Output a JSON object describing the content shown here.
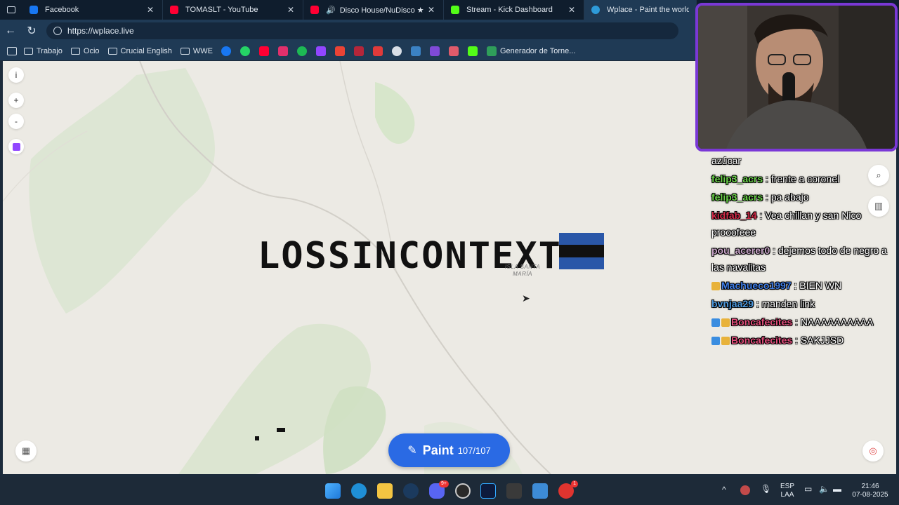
{
  "tabs": [
    {
      "title": "Facebook",
      "color": "#1877f2",
      "close": "✕"
    },
    {
      "title": "TOMASLT - YouTube",
      "color": "#ff0033",
      "close": "✕"
    },
    {
      "title": "Disco House/NuDisco ★ Me",
      "color": "#ff0033",
      "close": "✕"
    },
    {
      "title": "Stream - Kick Dashboard",
      "color": "#53fc18",
      "close": "✕"
    },
    {
      "title": "Wplace - Paint the world",
      "color": "#2e9ad8",
      "close": ""
    }
  ],
  "address": {
    "url": "https://wplace.live"
  },
  "bookmarks": {
    "folders": [
      "Trabajo",
      "Ocio",
      "Crucial English",
      "WWE"
    ],
    "last": "Generador de Torne..."
  },
  "map": {
    "controls": [
      "i",
      "+",
      "-"
    ],
    "title_text": "LOSSINCONTEXTO",
    "label_line1": "ISLA SANTA",
    "label_line2": "MARÍA",
    "flag_colors": [
      "#1a4fa0",
      "#111111",
      "#1a4fa0"
    ],
    "paint_label": "Paint",
    "paint_count": "107/107"
  },
  "chat": [
    {
      "user": "",
      "text": "azúcar",
      "color": "#ffffff"
    },
    {
      "user": "felip3_acrs",
      "text": " : frente a coronel",
      "color": "#6bd34a"
    },
    {
      "user": "felip3_acrs",
      "text": " : pa abajo",
      "color": "#6bd34a"
    },
    {
      "user": "kidfab_14",
      "text": " : Vea chillan y san Nico prooofeee",
      "color": "#d42d4a"
    },
    {
      "user": "pou_acerer0",
      "text": " : dejemos todo de negro a las navalitas",
      "color": "#c7a4c7"
    },
    {
      "user": "Machueco1997",
      "text": " : BIEN WN",
      "color": "#3f7ee8"
    },
    {
      "user": "bvnjaa29",
      "text": " : manden link",
      "color": "#4d9ae0"
    },
    {
      "user": "Boncafecites",
      "text": " : NAAAAAAAAAA",
      "color": "#e24d7b"
    },
    {
      "user": "Boncafecites",
      "text": " : SAKJJSD",
      "color": "#e24d7b"
    }
  ],
  "taskbar": {
    "lang1": "ESP",
    "lang2": "LAA",
    "time": "21:46",
    "date": "07-08-2025",
    "discord_badge": "9+",
    "app_badge": "1"
  }
}
